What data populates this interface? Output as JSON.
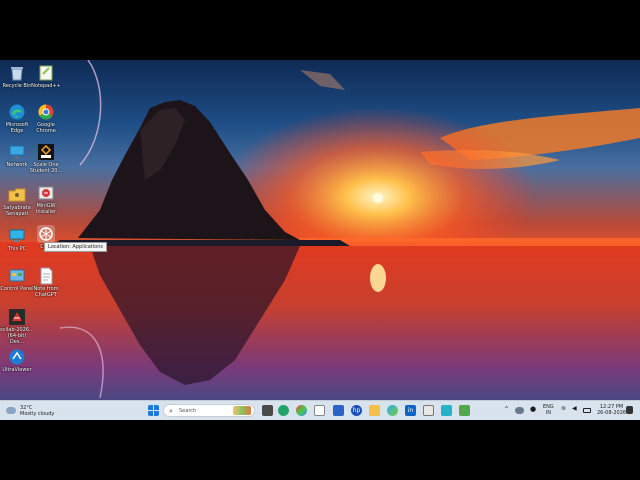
{
  "desktop": {
    "icons": [
      {
        "label": "Recycle Bin",
        "icon": "recycle-bin-icon"
      },
      {
        "label": "Notepad++",
        "icon": "notepad-plus-plus-icon"
      },
      {
        "label": "Microsoft Edge",
        "icon": "edge-icon"
      },
      {
        "label": "Google Chrome",
        "icon": "chrome-icon"
      },
      {
        "label": "Network",
        "icon": "network-icon"
      },
      {
        "label": "Scale One Student 20...",
        "icon": "scale-one-icon"
      },
      {
        "label": "Satyabrata Senapati",
        "icon": "user-folder-icon"
      },
      {
        "label": "MiniGW Installer",
        "icon": "installer-icon"
      },
      {
        "label": "This PC",
        "icon": "this-pc-icon"
      },
      {
        "label": "Ch...",
        "icon": "chatgpt-icon"
      },
      {
        "label": "Control Panel",
        "icon": "control-panel-icon"
      },
      {
        "label": "Note from ChatGPT",
        "icon": "text-file-icon"
      },
      {
        "label": "scilab-2026... (64-bit) Des...",
        "icon": "scilab-icon"
      },
      {
        "label": "UltraViewer",
        "icon": "ultraviewer-icon"
      }
    ],
    "tooltip": "Location: Applications"
  },
  "taskbar": {
    "weather_temp": "32°C",
    "weather_condition": "Mostly cloudy",
    "search_placeholder": "Search",
    "lang_top": "ENG",
    "lang_bottom": "IN",
    "time": "12:27 PM",
    "date": "26-08-2026"
  }
}
